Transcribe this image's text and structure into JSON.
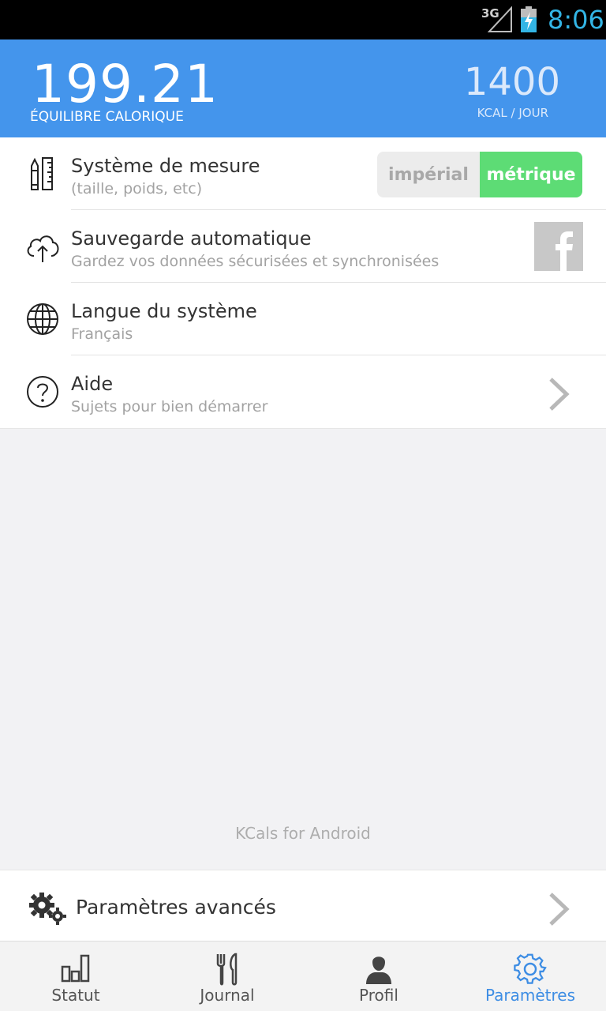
{
  "status_bar": {
    "network": "3G",
    "time": "8:06"
  },
  "header": {
    "balance_value": "199.21",
    "balance_label": "ÉQUILIBRE CALORIQUE",
    "goal_value": "1400",
    "goal_label": "KCAL / JOUR"
  },
  "settings": [
    {
      "title": "Système de mesure",
      "subtitle": "(taille, poids, etc)",
      "icon": "ruler-pencil-icon",
      "toggle": {
        "options": [
          "impérial",
          "métrique"
        ],
        "selected": "métrique"
      }
    },
    {
      "title": "Sauvegarde automatique",
      "subtitle": "Gardez vos données sécurisées et synchronisées",
      "icon": "cloud-upload-icon"
    },
    {
      "title": "Langue du système",
      "subtitle": "Français",
      "icon": "globe-icon"
    },
    {
      "title": "Aide",
      "subtitle": "Sujets pour bien démarrer",
      "icon": "help-icon"
    }
  ],
  "footer_note": "KCals for Android",
  "advanced": {
    "label": "Paramètres avancés",
    "icon": "gears-icon"
  },
  "bottom_nav": [
    {
      "label": "Statut",
      "icon": "bar-chart-icon",
      "active": false
    },
    {
      "label": "Journal",
      "icon": "fork-knife-icon",
      "active": false
    },
    {
      "label": "Profil",
      "icon": "person-icon",
      "active": false
    },
    {
      "label": "Paramètres",
      "icon": "gear-icon",
      "active": true
    }
  ],
  "colors": {
    "header_bg": "#4495ec",
    "toggle_on": "#5ddc75",
    "active_nav": "#3d8de4",
    "status_time": "#33b5e5"
  }
}
